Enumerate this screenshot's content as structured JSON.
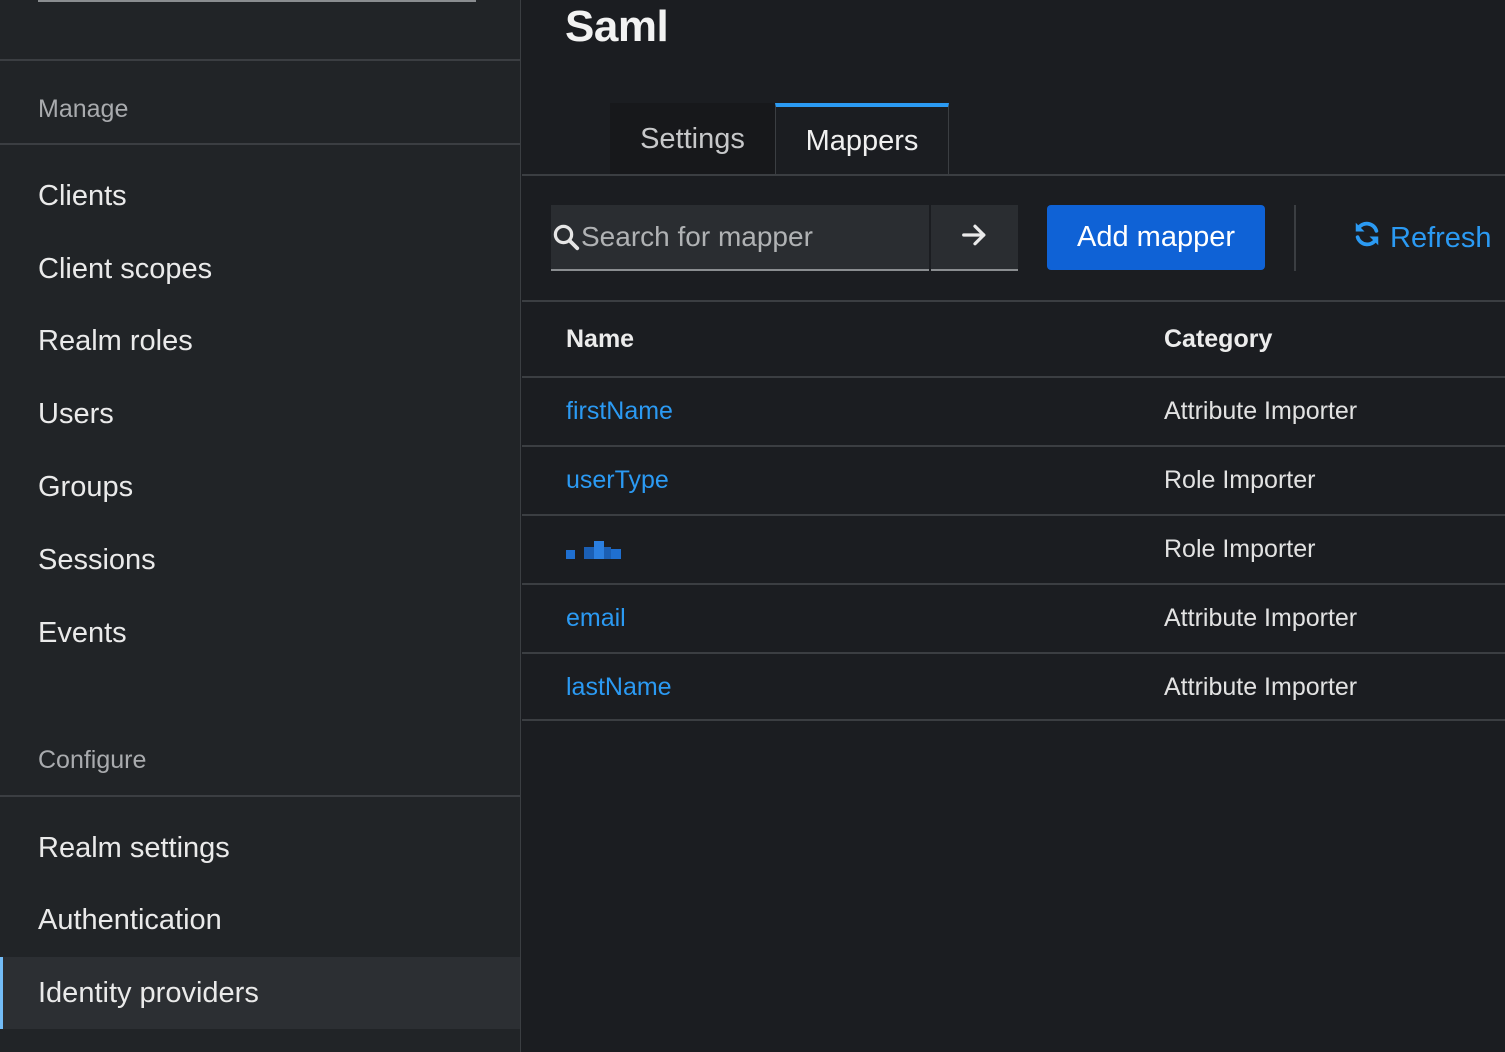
{
  "sidebar": {
    "sections": [
      {
        "label": "Manage",
        "items": [
          "Clients",
          "Client scopes",
          "Realm roles",
          "Users",
          "Groups",
          "Sessions",
          "Events"
        ]
      },
      {
        "label": "Configure",
        "items": [
          "Realm settings",
          "Authentication",
          "Identity providers"
        ]
      }
    ],
    "active_item": "Identity providers"
  },
  "page": {
    "title": "Saml"
  },
  "tabs": [
    {
      "label": "Settings",
      "active": false
    },
    {
      "label": "Mappers",
      "active": true
    }
  ],
  "toolbar": {
    "search_placeholder": "Search for mapper",
    "search_value": "",
    "add_label": "Add mapper",
    "refresh_label": "Refresh"
  },
  "table": {
    "columns": [
      "Name",
      "Category"
    ],
    "rows": [
      {
        "name": "firstName",
        "category": "Attribute Importer"
      },
      {
        "name": "userType",
        "category": "Role Importer"
      },
      {
        "name": "",
        "category": "Role Importer",
        "redacted": true
      },
      {
        "name": "email",
        "category": "Attribute Importer"
      },
      {
        "name": "lastName",
        "category": "Attribute Importer"
      }
    ]
  },
  "colors": {
    "accent": "#2b9af3",
    "primary_button": "#0f62d6",
    "background": "#1b1d21",
    "sidebar": "#212427"
  }
}
